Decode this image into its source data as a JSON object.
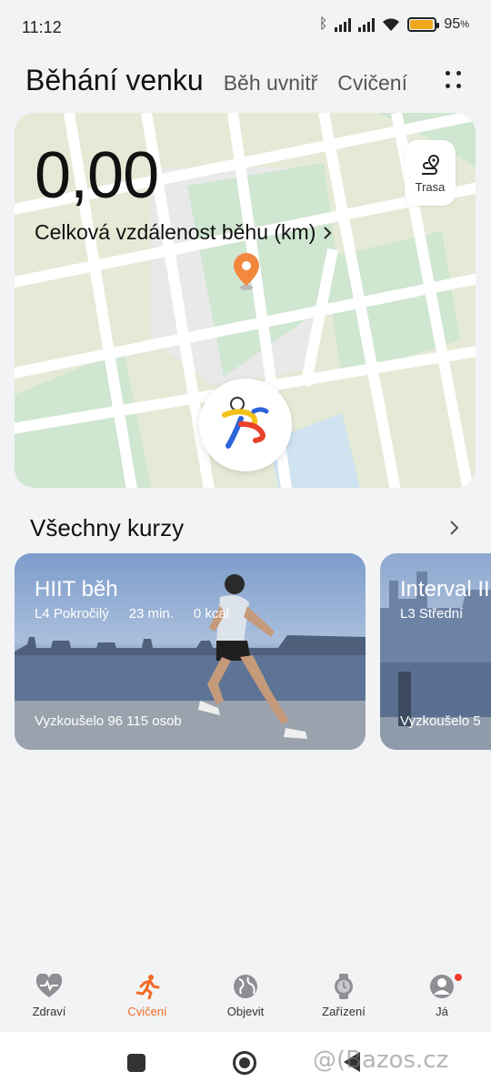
{
  "status": {
    "time": "11:12",
    "battery_percent": "95",
    "battery_level": 0.95
  },
  "tabs": {
    "active": "Běhání venku",
    "items": [
      "Běh uvnitř",
      "Cvičení"
    ]
  },
  "map_card": {
    "distance_value": "0,00",
    "distance_label": "Celková vzdálenost běhu (km)",
    "route_label": "Trasa"
  },
  "courses": {
    "title": "Všechny kurzy",
    "cards": [
      {
        "title": "HIIT běh",
        "level": "L4 Pokročilý",
        "duration": "23 min.",
        "calories": "0 kcal",
        "tried": "Vyzkoušelo 96 115 osob"
      },
      {
        "title": "Interval II",
        "level": "L3 Střední",
        "tried": "Vyzkoušelo 5"
      }
    ]
  },
  "bottom_nav": [
    {
      "label": "Zdraví",
      "icon": "heart-pulse-icon"
    },
    {
      "label": "Cvičení",
      "icon": "running-person-icon",
      "active": true
    },
    {
      "label": "Objevit",
      "icon": "globe-icon"
    },
    {
      "label": "Zařízení",
      "icon": "watch-icon"
    },
    {
      "label": "Já",
      "icon": "profile-icon",
      "badge": true
    }
  ],
  "watermark": "@(Bazos.cz",
  "colors": {
    "accent": "#f26a25",
    "battery": "#f0a81e",
    "map_park": "#cfe6d1",
    "map_water": "#cfe3f1"
  }
}
